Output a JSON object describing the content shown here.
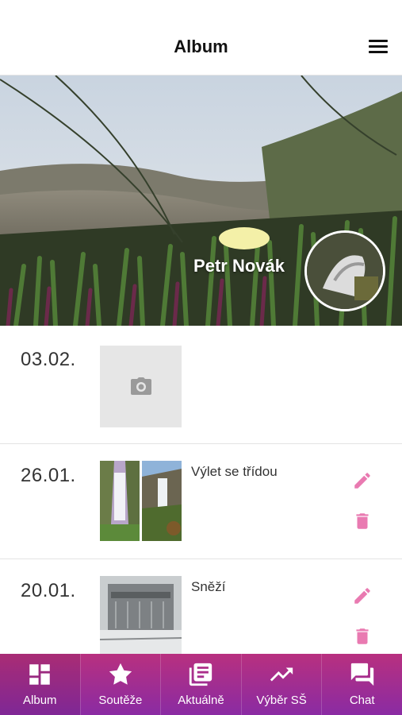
{
  "header": {
    "title": "Album",
    "menu_icon": "hamburger-menu-icon"
  },
  "profile": {
    "name": "Petr Novák"
  },
  "entries": [
    {
      "date": "03.02.",
      "caption": "",
      "thumbnail": "camera-placeholder-icon"
    },
    {
      "date": "26.01.",
      "caption": "Výlet se třídou",
      "actions": [
        "edit-icon",
        "delete-icon"
      ]
    },
    {
      "date": "20.01.",
      "caption": "Sněží",
      "actions": [
        "edit-icon",
        "delete-icon"
      ]
    }
  ],
  "tabs": [
    {
      "label": "Album",
      "icon": "album-grid-icon",
      "active": true
    },
    {
      "label": "Soutěže",
      "icon": "star-icon"
    },
    {
      "label": "Aktuálně",
      "icon": "news-icon"
    },
    {
      "label": "Výběr SŠ",
      "icon": "trending-up-icon"
    },
    {
      "label": "Chat",
      "icon": "chat-icon"
    }
  ],
  "colors": {
    "accent": "#e97ab1",
    "tabbar_top": "#b8307f",
    "tabbar_bottom": "#8a2ba3"
  }
}
